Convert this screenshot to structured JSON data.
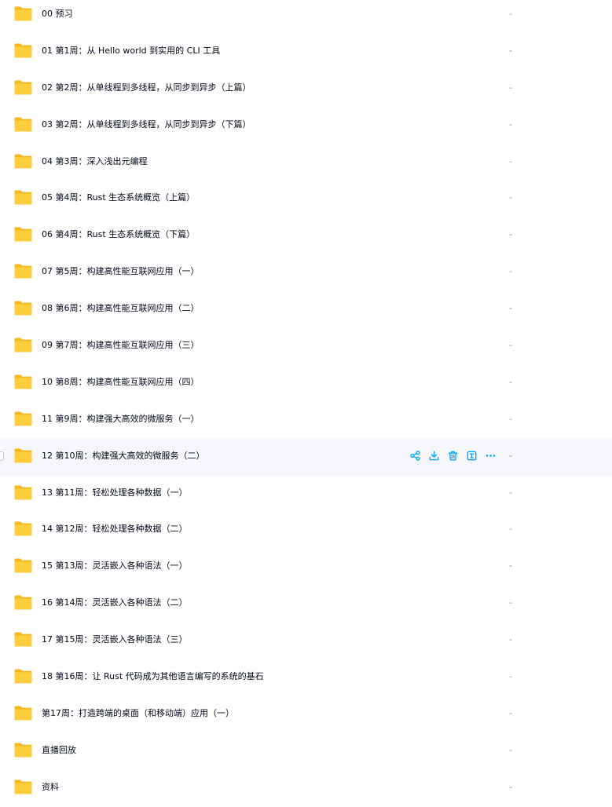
{
  "colors": {
    "folder_back": "#f6b71d",
    "folder_front": "#fecd3e",
    "action_icon": "#06a7ff",
    "hover_row_bg": "#f5f7fa",
    "text_primary": "#03081a",
    "text_secondary": "#878c9c"
  },
  "icons": {
    "folder": "folder-icon",
    "actions": [
      "share-icon",
      "download-icon",
      "trash-icon",
      "rename-icon",
      "more-icon"
    ]
  },
  "files": [
    {
      "name": "00 预习",
      "size": "-"
    },
    {
      "name": "01 第1周：从 Hello world 到实用的 CLI 工具",
      "size": "-"
    },
    {
      "name": "02 第2周：从单线程到多线程，从同步到异步（上篇）",
      "size": "-"
    },
    {
      "name": "03 第2周：从单线程到多线程，从同步到异步（下篇）",
      "size": "-"
    },
    {
      "name": "04 第3周：深入浅出元编程",
      "size": "-"
    },
    {
      "name": "05 第4周：Rust 生态系统概览（上篇）",
      "size": "-"
    },
    {
      "name": "06 第4周：Rust 生态系统概览（下篇）",
      "size": "-"
    },
    {
      "name": "07 第5周：构建高性能互联网应用（一）",
      "size": "-"
    },
    {
      "name": "08 第6周：构建高性能互联网应用（二）",
      "size": "-"
    },
    {
      "name": "09 第7周：构建高性能互联网应用（三）",
      "size": "-"
    },
    {
      "name": "10 第8周：构建高性能互联网应用（四）",
      "size": "-"
    },
    {
      "name": "11 第9周：构建强大高效的微服务（一）",
      "size": "-"
    },
    {
      "name": "12 第10周：构建强大高效的微服务（二）",
      "size": "-",
      "hovered": true
    },
    {
      "name": "13 第11周：轻松处理各种数据（一）",
      "size": "-"
    },
    {
      "name": "14 第12周：轻松处理各种数据（二）",
      "size": "-"
    },
    {
      "name": "15 第13周：灵活嵌入各种语法（一）",
      "size": "-"
    },
    {
      "name": "16 第14周：灵活嵌入各种语法（二）",
      "size": "-"
    },
    {
      "name": "17 第15周：灵活嵌入各种语法（三）",
      "size": "-"
    },
    {
      "name": "18 第16周：让 Rust 代码成为其他语言编写的系统的基石",
      "size": "-"
    },
    {
      "name": "第17周：打造跨端的桌面（和移动端）应用（一）",
      "size": "-"
    },
    {
      "name": "直播回放",
      "size": "-"
    },
    {
      "name": "资料",
      "size": "-"
    }
  ]
}
